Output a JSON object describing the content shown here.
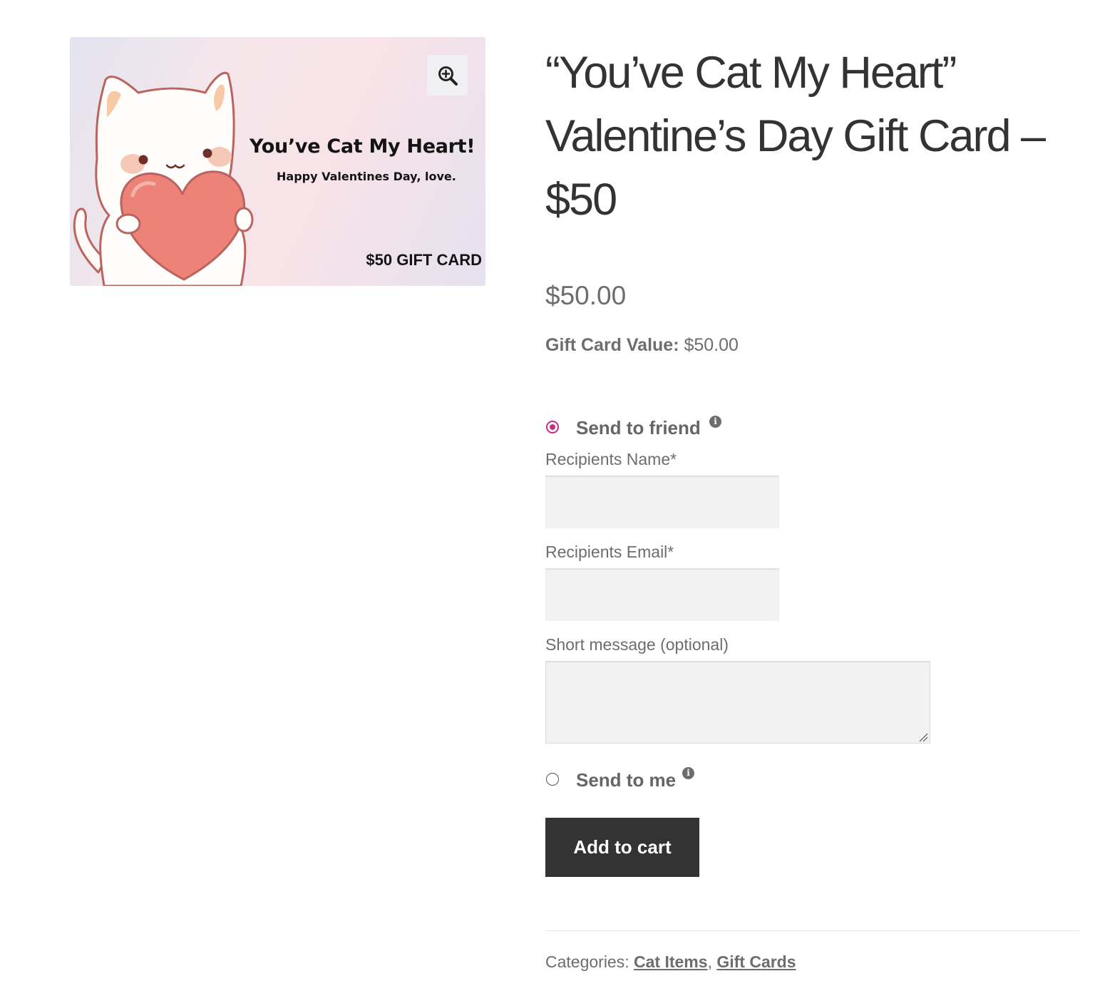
{
  "gallery": {
    "card_title": "You’ve Cat My Heart!",
    "card_subtitle": "Happy Valentines Day, love.",
    "card_value": "$50 GIFT CARD",
    "zoom_icon": "zoom-in-icon"
  },
  "product": {
    "title": "“You’ve Cat My Heart” Valentine’s Day Gift Card – $50",
    "price": "$50.00",
    "gift_card_value_label": "Gift Card Value:",
    "gift_card_value": "$50.00"
  },
  "options": {
    "send_to_friend": {
      "label": "Send to friend",
      "selected": true,
      "info_icon": "info-icon"
    },
    "send_to_me": {
      "label": "Send to me",
      "selected": false,
      "info_icon": "info-icon"
    }
  },
  "form": {
    "recipient_name_label": "Recipients Name*",
    "recipient_name_value": "",
    "recipient_email_label": "Recipients Email*",
    "recipient_email_value": "",
    "message_label": "Short message (optional)",
    "message_value": ""
  },
  "actions": {
    "add_to_cart": "Add to cart"
  },
  "meta": {
    "categories_label": "Categories:",
    "categories": [
      "Cat Items",
      "Gift Cards"
    ],
    "separator": ", "
  },
  "colors": {
    "accent": "#c42e85",
    "button_bg": "#333333",
    "text": "#6d6d6d",
    "heart": "#ec8278"
  }
}
